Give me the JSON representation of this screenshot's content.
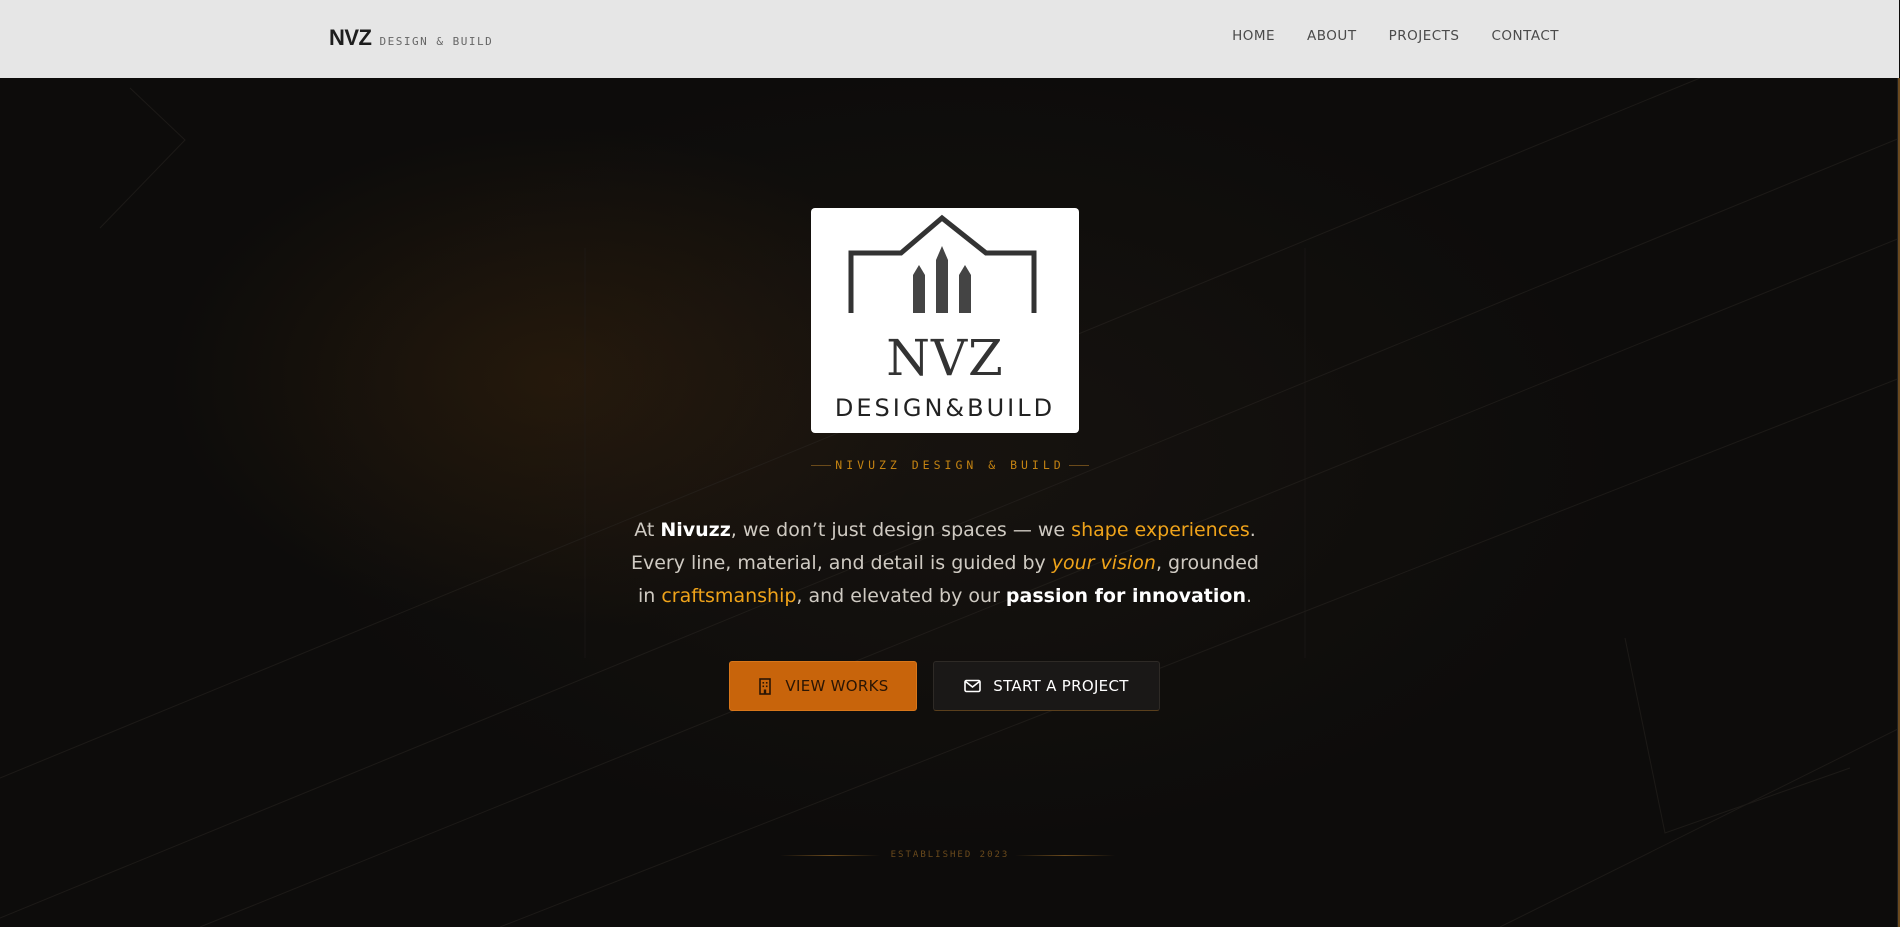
{
  "header": {
    "brand_mark": "NVZ",
    "brand_sub": "DESIGN & BUILD",
    "nav": [
      "HOME",
      "ABOUT",
      "PROJECTS",
      "CONTACT"
    ]
  },
  "hero": {
    "logo": {
      "mark": "NVZ",
      "wordmark": "DESIGN&BUILD"
    },
    "eyebrow": "NIVUZZ DESIGN & BUILD",
    "tagline": {
      "t1": "At ",
      "t2": "Nivuzz",
      "t3": ", we don’t just design spaces — we ",
      "t4": "shape experiences",
      "t5": ". Every line, material, and detail is guided by ",
      "t6": "your vision",
      "t7": ", grounded in ",
      "t8": "craftsmanship",
      "t9": ", and elevated by our ",
      "t10": "passion for innovation",
      "t11": "."
    },
    "buttons": {
      "primary": {
        "label": "VIEW WORKS",
        "icon": "building-icon"
      },
      "secondary": {
        "label": "START A PROJECT",
        "icon": "mail-icon"
      }
    },
    "established": "ESTABLISHED 2023"
  },
  "colors": {
    "accent": "#efa31a",
    "button_primary": "#c8640b",
    "header_bg": "#e6e6e6",
    "hero_bg": "#0d0c0b"
  }
}
